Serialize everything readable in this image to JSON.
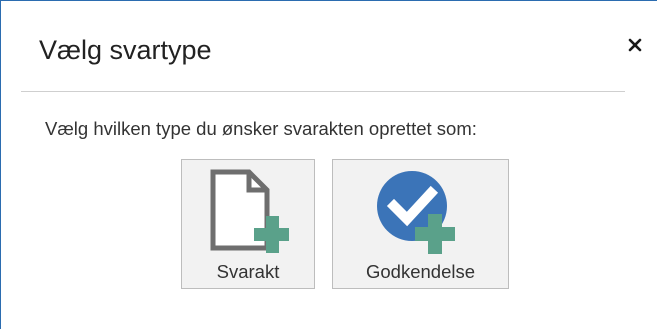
{
  "dialog": {
    "title": "Vælg svartype",
    "close_icon": "close-icon",
    "prompt": "Vælg hvilken type du ønsker svarakten oprettet som:",
    "options": [
      {
        "label": "Svarakt",
        "icon": "document-add-icon"
      },
      {
        "label": "Godkendelse",
        "icon": "approval-add-icon"
      }
    ]
  },
  "colors": {
    "accent_blue": "#3b74b8",
    "plus_green": "#5aa18a",
    "document_gray": "#6e6e6e",
    "button_bg": "#f2f2f2",
    "button_border": "#bdbdbd"
  }
}
